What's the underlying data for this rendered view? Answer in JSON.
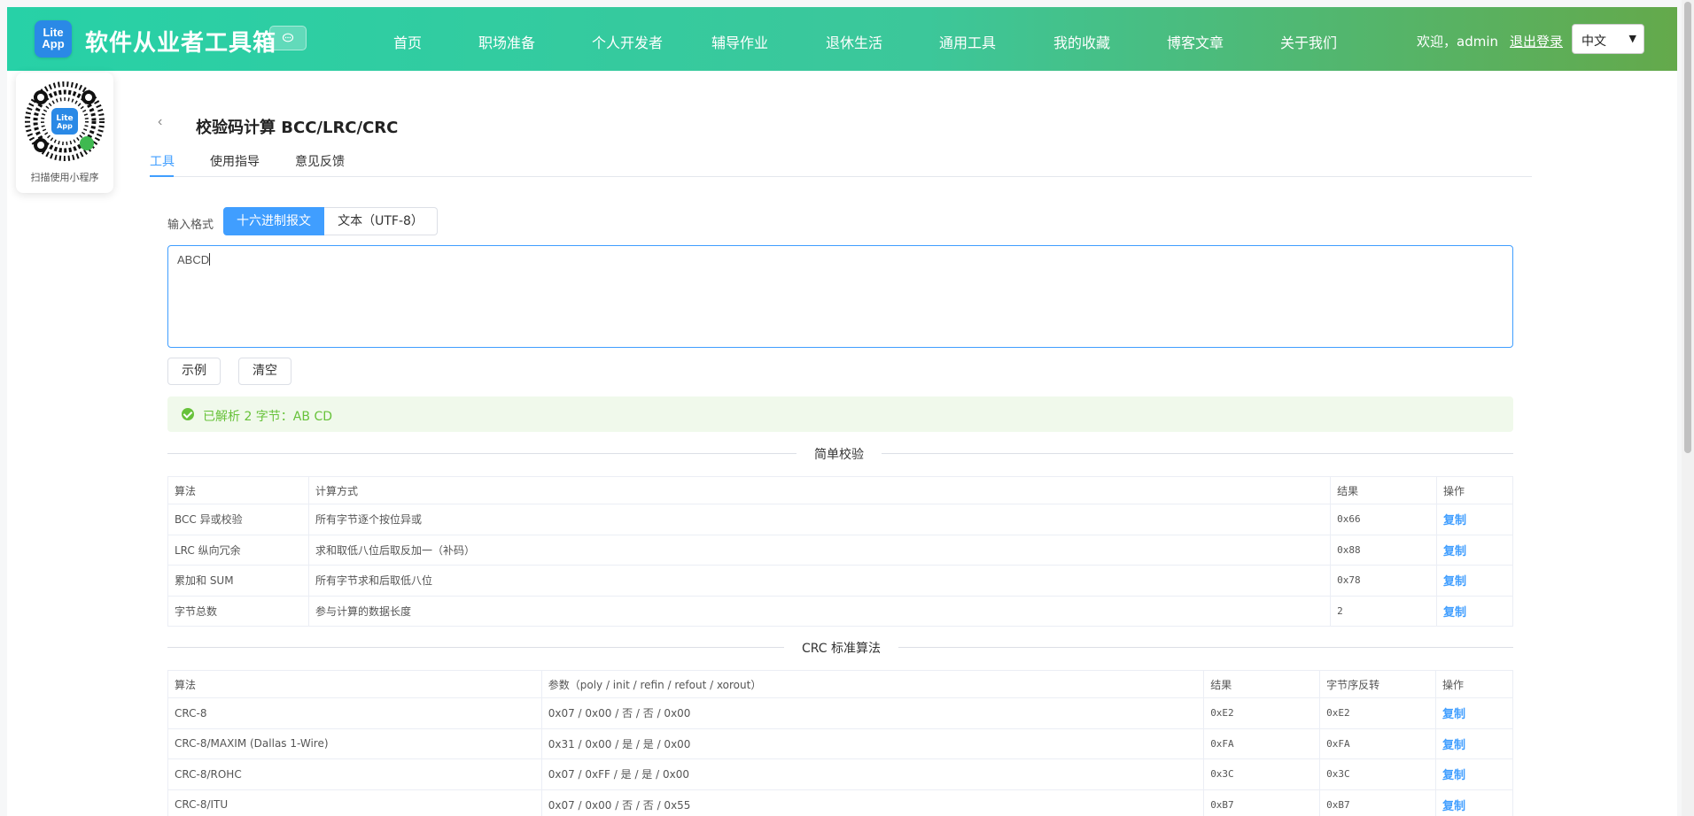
{
  "header": {
    "logo_text_1": "Lite",
    "logo_text_2": "App",
    "brand": "软件从业者工具箱",
    "nav": [
      "首页",
      "职场准备",
      "个人开发者",
      "辅导作业",
      "退休生活",
      "通用工具",
      "我的收藏",
      "博客文章",
      "关于我们"
    ],
    "welcome": "欢迎，admin",
    "logout": "退出登录",
    "language": "中文"
  },
  "qr": {
    "label": "扫描使用小程序"
  },
  "page": {
    "title": "校验码计算 BCC/LRC/CRC",
    "tabs": [
      "工具",
      "使用指导",
      "意见反馈"
    ],
    "active_tab": "工具"
  },
  "input": {
    "format_label": "输入格式",
    "format_options": [
      "十六进制报文",
      "文本（UTF-8）"
    ],
    "selected_format": "十六进制报文",
    "value": "ABCD",
    "example_button": "示例",
    "clear_button": "清空"
  },
  "alert": {
    "text": "已解析 2 字节：AB CD",
    "color": "#67c23a"
  },
  "simple": {
    "section_title": "简单校验",
    "headers": [
      "算法",
      "计算方式",
      "结果",
      "操作"
    ],
    "rows": [
      {
        "algo": "BCC 异或校验",
        "method": "所有字节逐个按位异或",
        "result": "0x66",
        "action": "复制"
      },
      {
        "algo": "LRC 纵向冗余",
        "method": "求和取低八位后取反加一（补码）",
        "result": "0x88",
        "action": "复制"
      },
      {
        "algo": "累加和 SUM",
        "method": "所有字节求和后取低八位",
        "result": "0x78",
        "action": "复制"
      },
      {
        "algo": "字节总数",
        "method": "参与计算的数据长度",
        "result": "2",
        "action": "复制"
      }
    ]
  },
  "crc": {
    "section_title": "CRC 标准算法",
    "headers": [
      "算法",
      "参数（poly / init / refin / refout / xorout）",
      "结果",
      "字节序反转",
      "操作"
    ],
    "rows": [
      {
        "algo": "CRC-8",
        "params": "0x07 / 0x00 / 否 / 否 / 0x00",
        "result": "0xE2",
        "reversed": "0xE2",
        "action": "复制"
      },
      {
        "algo": "CRC-8/MAXIM (Dallas 1-Wire)",
        "params": "0x31 / 0x00 / 是 / 是 / 0x00",
        "result": "0xFA",
        "reversed": "0xFA",
        "action": "复制"
      },
      {
        "algo": "CRC-8/ROHC",
        "params": "0x07 / 0xFF / 是 / 是 / 0x00",
        "result": "0x3C",
        "reversed": "0x3C",
        "action": "复制"
      },
      {
        "algo": "CRC-8/ITU",
        "params": "0x07 / 0x00 / 否 / 否 / 0x55",
        "result": "0xB7",
        "reversed": "0xB7",
        "action": "复制"
      }
    ]
  },
  "colors": {
    "accent": "#409eff",
    "header_start": "#27d1a7",
    "header_end": "#64a94b",
    "success": "#67c23a"
  }
}
